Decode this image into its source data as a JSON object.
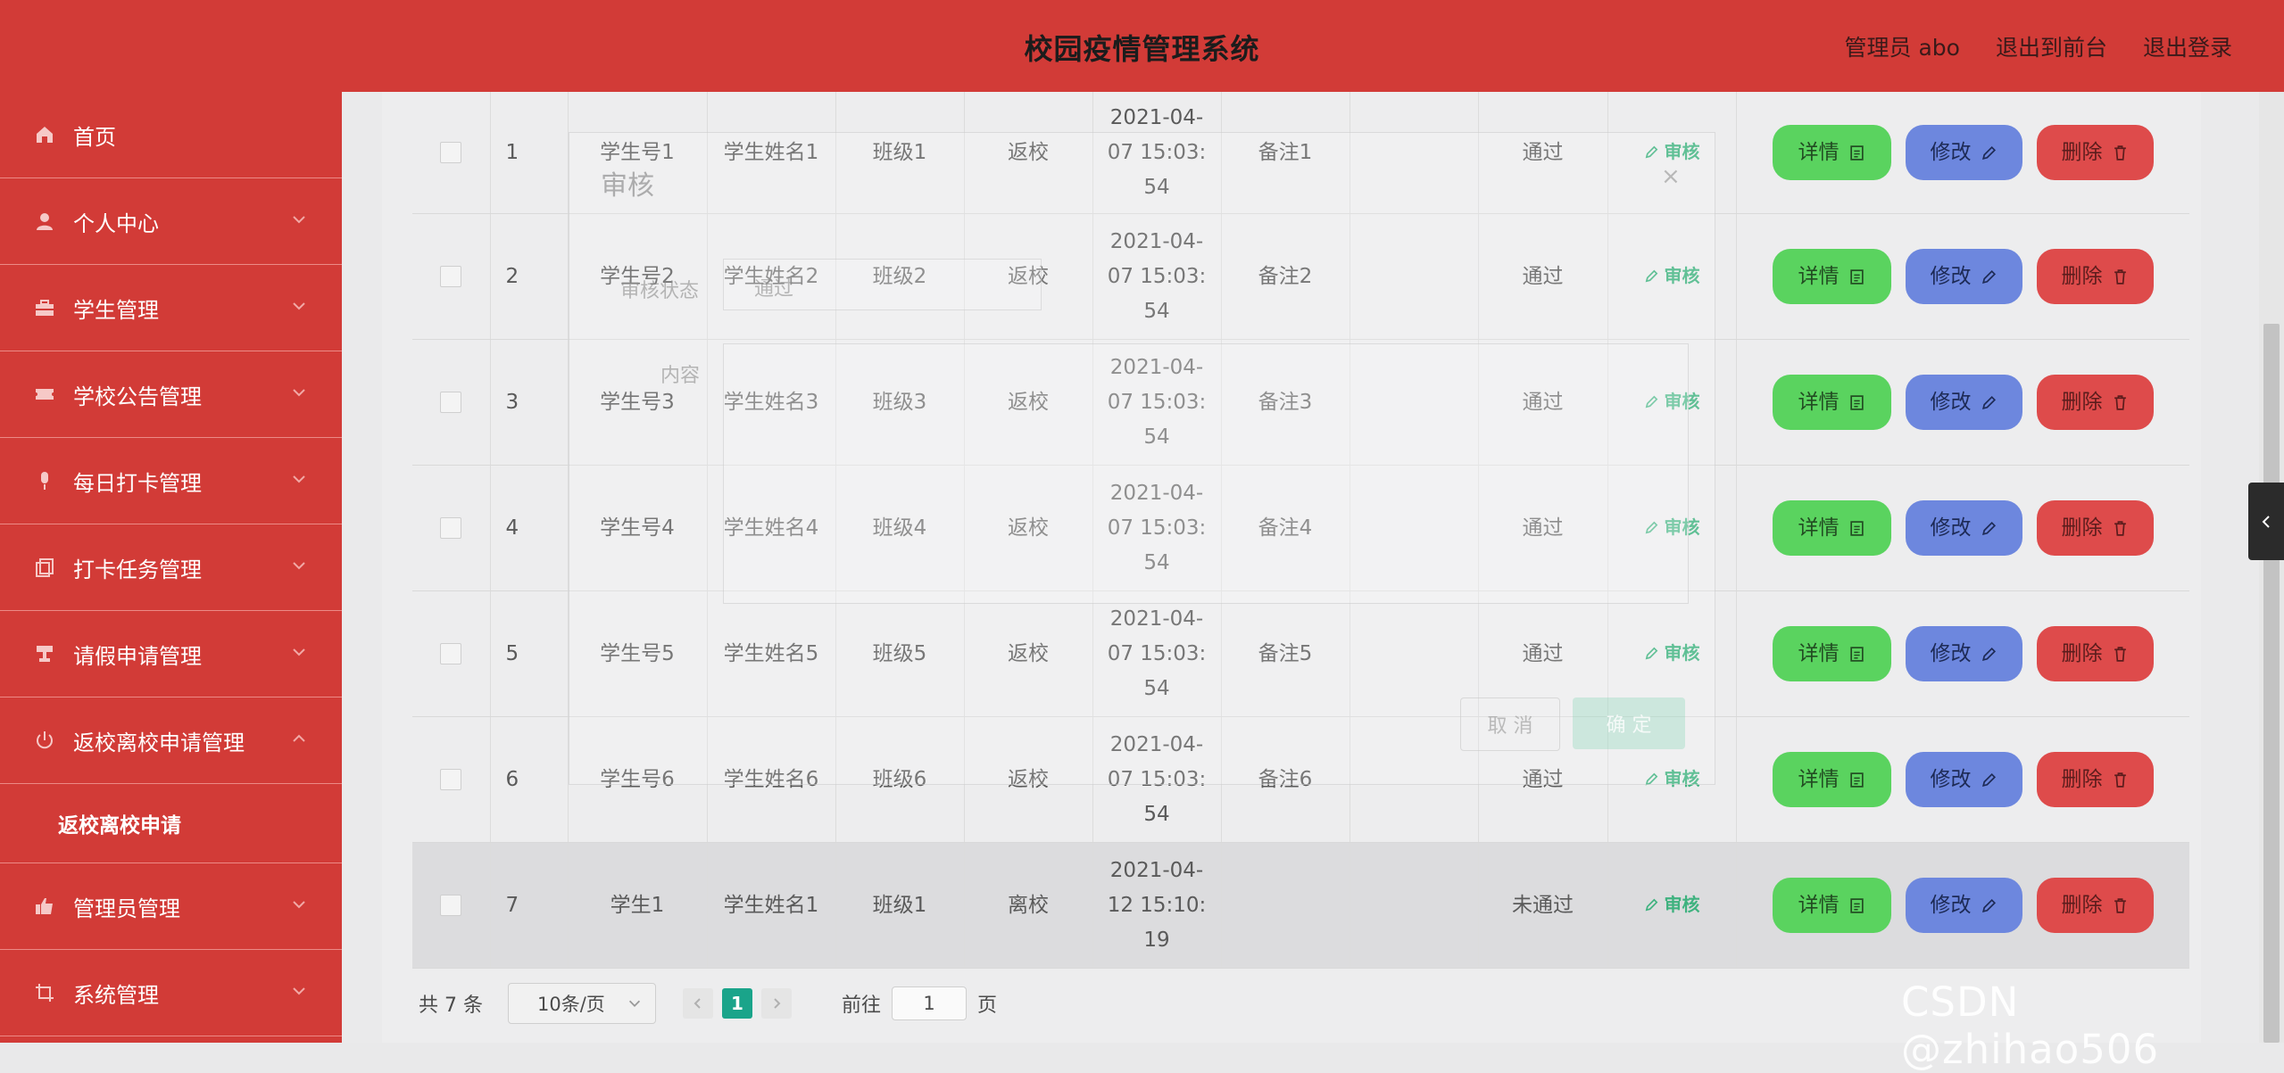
{
  "header": {
    "title": "校园疫情管理系统",
    "links": [
      "管理员 abo",
      "退出到前台",
      "退出登录"
    ]
  },
  "sidebar": {
    "items": [
      {
        "label": "首页",
        "icon": "home-icon",
        "chevron": ""
      },
      {
        "label": "个人中心",
        "icon": "user-icon",
        "chevron": "down"
      },
      {
        "label": "学生管理",
        "icon": "briefcase-icon",
        "chevron": "down"
      },
      {
        "label": "学校公告管理",
        "icon": "ticket-icon",
        "chevron": "down"
      },
      {
        "label": "每日打卡管理",
        "icon": "microphone-icon",
        "chevron": "down"
      },
      {
        "label": "打卡任务管理",
        "icon": "copy-icon",
        "chevron": "down"
      },
      {
        "label": "请假申请管理",
        "icon": "stamp-icon",
        "chevron": "down"
      },
      {
        "label": "返校离校申请管理",
        "icon": "power-icon",
        "chevron": "up"
      }
    ],
    "submenu": "返校离校申请",
    "items_after": [
      {
        "label": "管理员管理",
        "icon": "thumbs-up-icon",
        "chevron": "down"
      },
      {
        "label": "系统管理",
        "icon": "crop-icon",
        "chevron": "down"
      }
    ]
  },
  "table": {
    "audit_label": "审核",
    "buttons": {
      "detail": "详情",
      "edit": "修改",
      "delete": "删除"
    },
    "rows": [
      {
        "no": "1",
        "sid": "学生号1",
        "name": "学生姓名1",
        "cls": "班级1",
        "type": "返校",
        "time": [
          "2021-04-",
          "07 15:03:",
          "54"
        ],
        "note": "备注1",
        "reply": "",
        "status": "通过"
      },
      {
        "no": "2",
        "sid": "学生号2",
        "name": "学生姓名2",
        "cls": "班级2",
        "type": "返校",
        "time": [
          "2021-04-",
          "07 15:03:",
          "54"
        ],
        "note": "备注2",
        "reply": "",
        "status": "通过"
      },
      {
        "no": "3",
        "sid": "学生号3",
        "name": "学生姓名3",
        "cls": "班级3",
        "type": "返校",
        "time": [
          "2021-04-",
          "07 15:03:",
          "54"
        ],
        "note": "备注3",
        "reply": "",
        "status": "通过"
      },
      {
        "no": "4",
        "sid": "学生号4",
        "name": "学生姓名4",
        "cls": "班级4",
        "type": "返校",
        "time": [
          "2021-04-",
          "07 15:03:",
          "54"
        ],
        "note": "备注4",
        "reply": "",
        "status": "通过"
      },
      {
        "no": "5",
        "sid": "学生号5",
        "name": "学生姓名5",
        "cls": "班级5",
        "type": "返校",
        "time": [
          "2021-04-",
          "07 15:03:",
          "54"
        ],
        "note": "备注5",
        "reply": "",
        "status": "通过"
      },
      {
        "no": "6",
        "sid": "学生号6",
        "name": "学生姓名6",
        "cls": "班级6",
        "type": "返校",
        "time": [
          "2021-04-",
          "07 15:03:",
          "54"
        ],
        "note": "备注6",
        "reply": "",
        "status": "通过"
      },
      {
        "no": "7",
        "sid": "学生1",
        "name": "学生姓名1",
        "cls": "班级1",
        "type": "离校",
        "time": [
          "2021-04-",
          "12 15:10:",
          "19"
        ],
        "note": "",
        "reply": "",
        "status": "未通过"
      }
    ]
  },
  "pager": {
    "total": "共 7 条",
    "page_size": "10条/页",
    "current": "1",
    "goto_prefix": "前往",
    "goto_value": "1",
    "goto_suffix": "页"
  },
  "dialog": {
    "title": "审核",
    "close": "×",
    "status_label": "审核状态",
    "status_value": "通过",
    "content_label": "内容",
    "cancel": "取 消",
    "confirm": "确 定"
  },
  "watermark": "CSDN @zhihao506",
  "colors": {
    "header": "#d23b37",
    "sidebar": "#d23b37",
    "accent": "#1aa48a",
    "detail_button": "#5ad35f",
    "edit_button": "#6d87de",
    "delete_button": "#de4b4b"
  }
}
